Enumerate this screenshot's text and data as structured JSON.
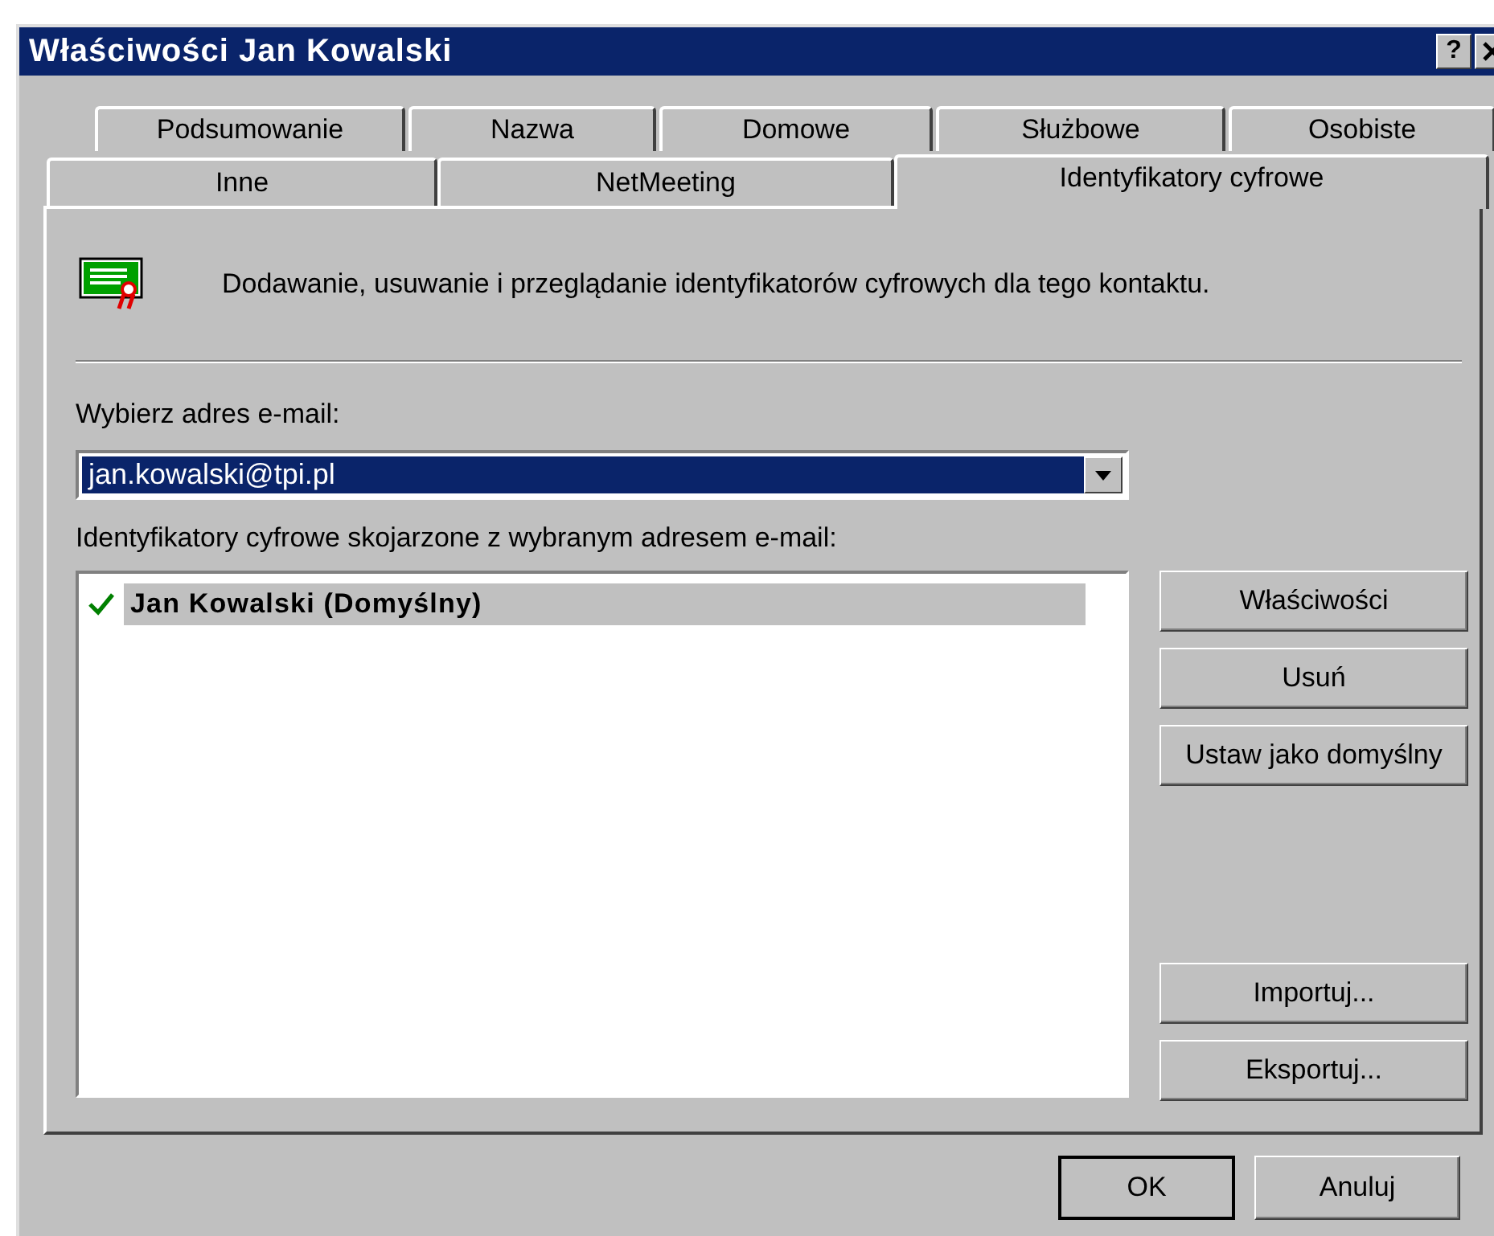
{
  "window": {
    "title": "Właściwości Jan Kowalski",
    "help": "?"
  },
  "tabs_row1": [
    {
      "label": "Podsumowanie",
      "selected": false
    },
    {
      "label": "Nazwa",
      "selected": false
    },
    {
      "label": "Domowe",
      "selected": false
    },
    {
      "label": "Służbowe",
      "selected": false
    },
    {
      "label": "Osobiste",
      "selected": false
    }
  ],
  "tabs_row2": [
    {
      "label": "Inne",
      "selected": false
    },
    {
      "label": "NetMeeting",
      "selected": false
    },
    {
      "label": "Identyfikatory cyfrowe",
      "selected": true
    }
  ],
  "description": "Dodawanie, usuwanie i przeglądanie identyfikatorów cyfrowych dla tego kontaktu.",
  "email_label": "Wybierz adres e-mail:",
  "email_select": {
    "value": "jan.kowalski@tpi.pl"
  },
  "ids_label": "Identyfikatory cyfrowe skojarzone z wybranym adresem e-mail:",
  "ids_list": [
    {
      "name": "Jan Kowalski (Domyślny)",
      "checked": true,
      "selected": true
    }
  ],
  "side_buttons_top": [
    "Właściwości",
    "Usuń",
    "Ustaw jako domyślny"
  ],
  "side_buttons_bottom": [
    "Importuj...",
    "Eksportuj..."
  ],
  "dialog_buttons": [
    {
      "label": "OK",
      "default": true
    },
    {
      "label": "Anuluj",
      "default": false
    }
  ]
}
